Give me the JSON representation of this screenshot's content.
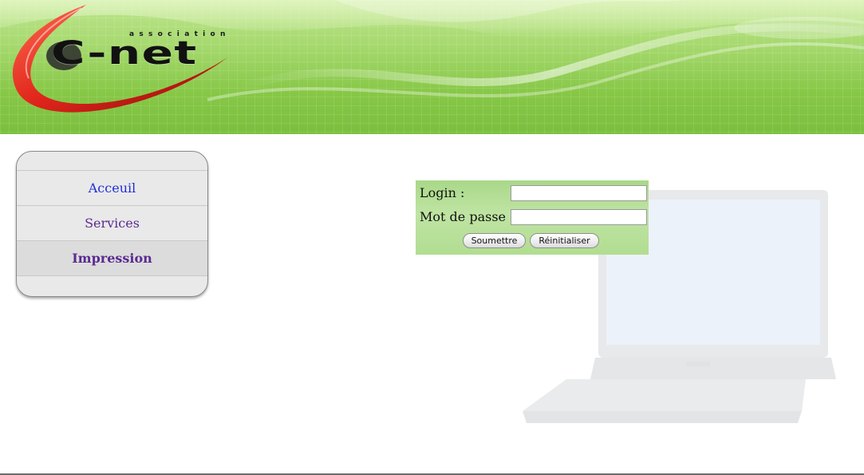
{
  "header": {
    "logo_small": "association",
    "logo_main": "C-net",
    "colors": {
      "banner_green": "#8fcd52",
      "swoosh_red": "#e0251b"
    }
  },
  "menu": {
    "items": [
      {
        "label": "Acceuil",
        "state": "link"
      },
      {
        "label": "Services",
        "state": "visited"
      },
      {
        "label": "Impression",
        "state": "active"
      }
    ]
  },
  "login": {
    "login_label": "Login :",
    "password_label": "Mot de passe :",
    "login_value": "",
    "password_value": "",
    "submit_label": "Soumettre",
    "reset_label": "Réinitialiser"
  },
  "background": {
    "decoration": "laptop-illustration"
  }
}
